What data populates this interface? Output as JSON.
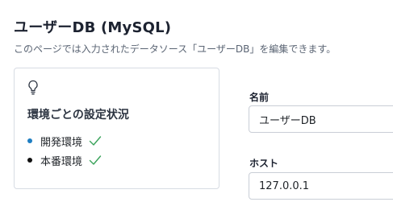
{
  "header": {
    "title": "ユーザーDB (MySQL)",
    "description": "このページでは入力されたデータソース「ユーザーDB」を編集できます。"
  },
  "status_card": {
    "icon": "lightbulb-icon",
    "title": "環境ごとの設定状況",
    "environments": [
      {
        "label": "開発環境",
        "dot_color": "#1f7ec2",
        "status": "configured",
        "status_icon": "check-icon",
        "check_color": "#3aa35b"
      },
      {
        "label": "本番環境",
        "dot_color": "#111111",
        "status": "configured",
        "status_icon": "check-icon",
        "check_color": "#3aa35b"
      }
    ]
  },
  "form": {
    "name": {
      "label": "名前",
      "value": "ユーザーDB"
    },
    "host": {
      "label": "ホスト",
      "value": "127.0.0.1"
    }
  }
}
